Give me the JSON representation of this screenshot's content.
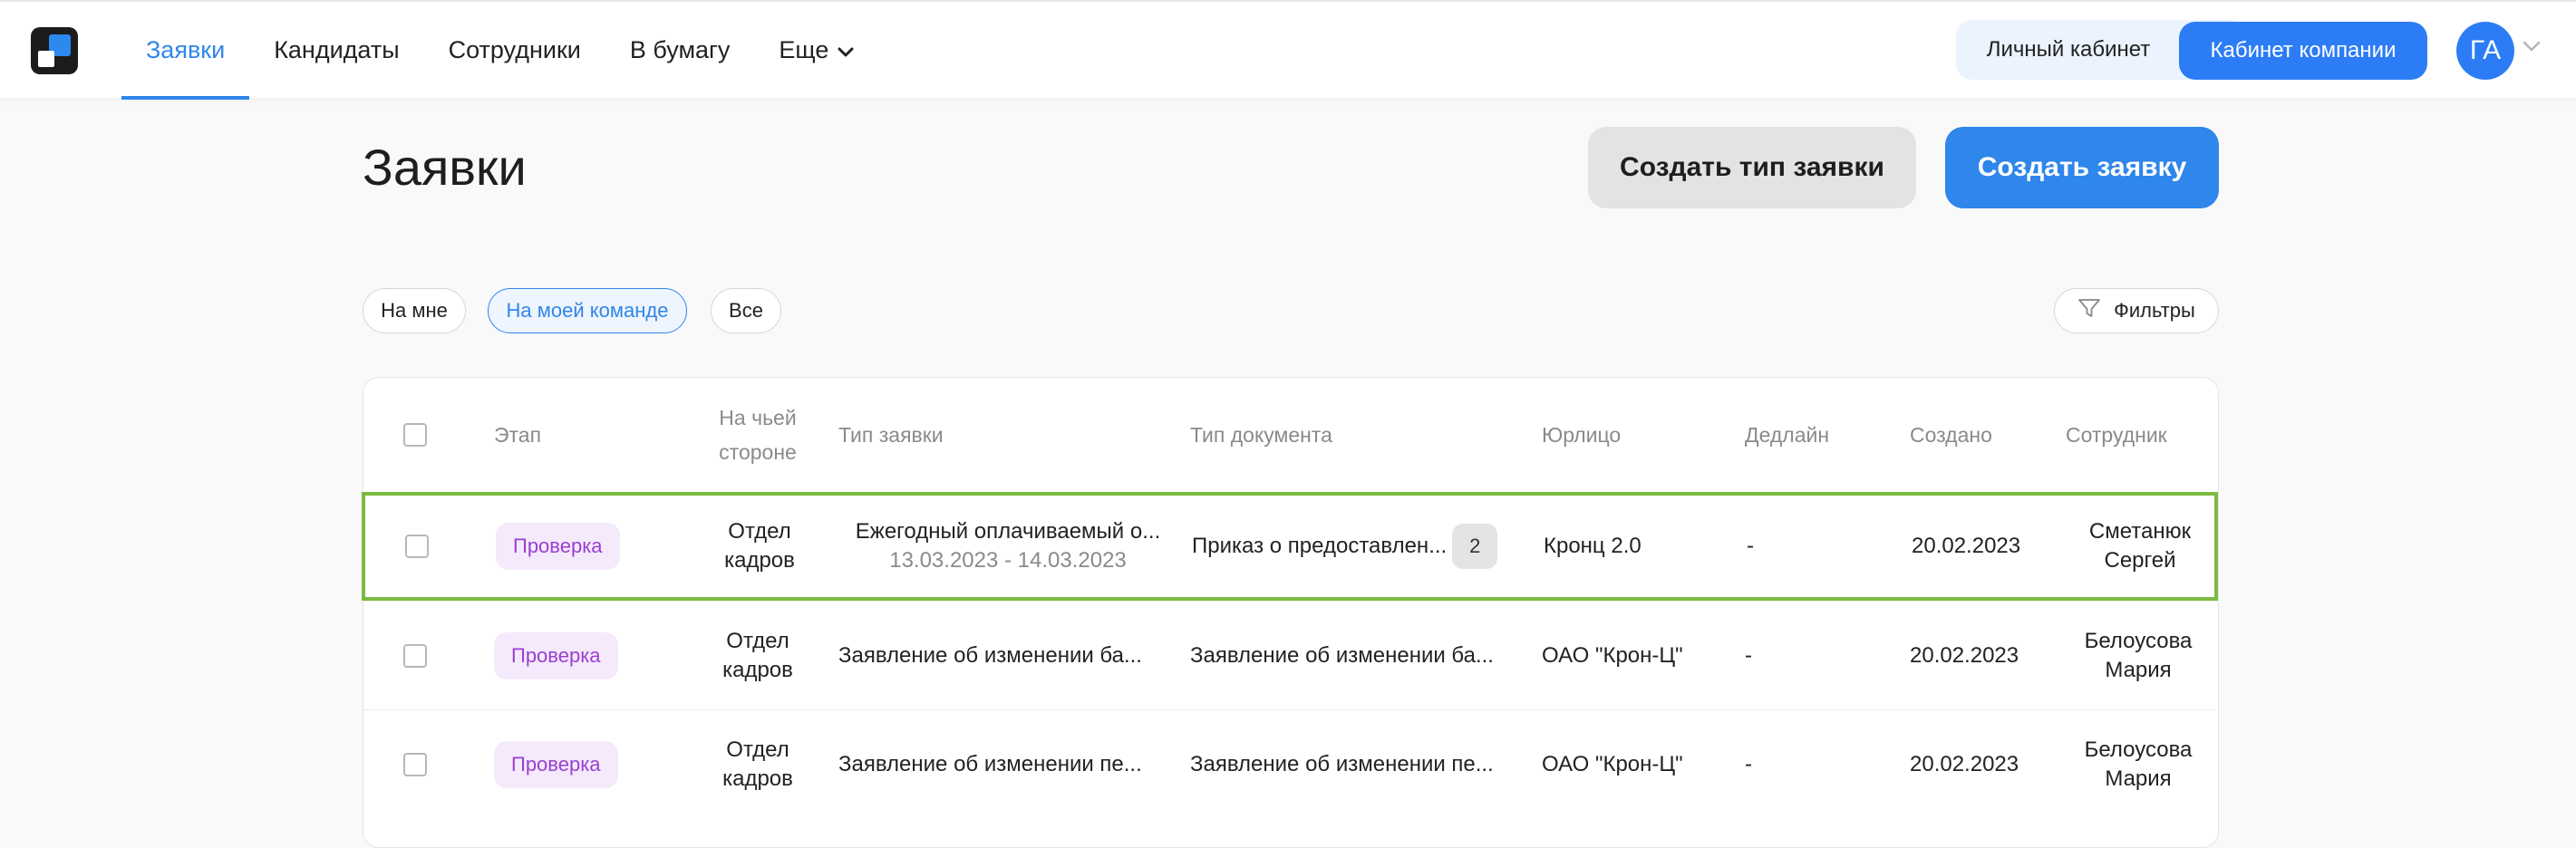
{
  "nav": {
    "items": [
      {
        "label": "Заявки",
        "active": true
      },
      {
        "label": "Кандидаты",
        "active": false
      },
      {
        "label": "Сотрудники",
        "active": false
      },
      {
        "label": "В бумагу",
        "active": false
      },
      {
        "label": "Еще",
        "active": false
      }
    ],
    "personal_cabinet": "Личный кабинет",
    "company_cabinet": "Кабинет компании",
    "avatar_initials": "ГА"
  },
  "page": {
    "title": "Заявки",
    "create_type_button": "Создать тип заявки",
    "create_request_button": "Создать заявку"
  },
  "filters": {
    "chips": [
      {
        "label": "На мне",
        "active": false
      },
      {
        "label": "На моей команде",
        "active": true
      },
      {
        "label": "Все",
        "active": false
      }
    ],
    "filters_button": "Фильтры"
  },
  "table": {
    "columns": [
      "Этап",
      "На чьей стороне",
      "Тип заявки",
      "Тип документа",
      "Юрлицо",
      "Дедлайн",
      "Создано",
      "Сотрудник"
    ],
    "side_header_lines": [
      "На чьей",
      "стороне"
    ],
    "rows": [
      {
        "stage": "Проверка",
        "side_lines": [
          "Отдел",
          "кадров"
        ],
        "request_type": "Ежегодный оплачиваемый о...",
        "request_dates": "13.03.2023 - 14.03.2023",
        "document_type": "Приказ о предоставлен...",
        "document_count": "2",
        "legal_entity": "Кронц 2.0",
        "deadline": "-",
        "created": "20.02.2023",
        "employee_lines": [
          "Сметанюк",
          "Сергей"
        ],
        "highlighted": true
      },
      {
        "stage": "Проверка",
        "side_lines": [
          "Отдел",
          "кадров"
        ],
        "request_type": "Заявление об изменении ба...",
        "document_type": "Заявление об изменении ба...",
        "legal_entity": "ОАО \"Крон-Ц\"",
        "deadline": "-",
        "created": "20.02.2023",
        "employee_lines": [
          "Белоусова",
          "Мария"
        ],
        "highlighted": false
      },
      {
        "stage": "Проверка",
        "side_lines": [
          "Отдел",
          "кадров"
        ],
        "request_type": "Заявление об изменении пе...",
        "document_type": "Заявление об изменении пе...",
        "legal_entity": "ОАО \"Крон-Ц\"",
        "deadline": "-",
        "created": "20.02.2023",
        "employee_lines": [
          "Белоусова",
          "Мария"
        ],
        "highlighted": false
      }
    ]
  },
  "colors": {
    "accent": "#2f86eb",
    "stage_badge_text": "#9b3fd1",
    "stage_badge_bg": "#f4eafb",
    "highlight_border": "#7cba41"
  },
  "icons": {
    "logo": "app-logo-icon",
    "more_chevron": "chevron-down-icon",
    "avatar_chevron": "chevron-down-icon",
    "filter": "funnel-icon"
  }
}
